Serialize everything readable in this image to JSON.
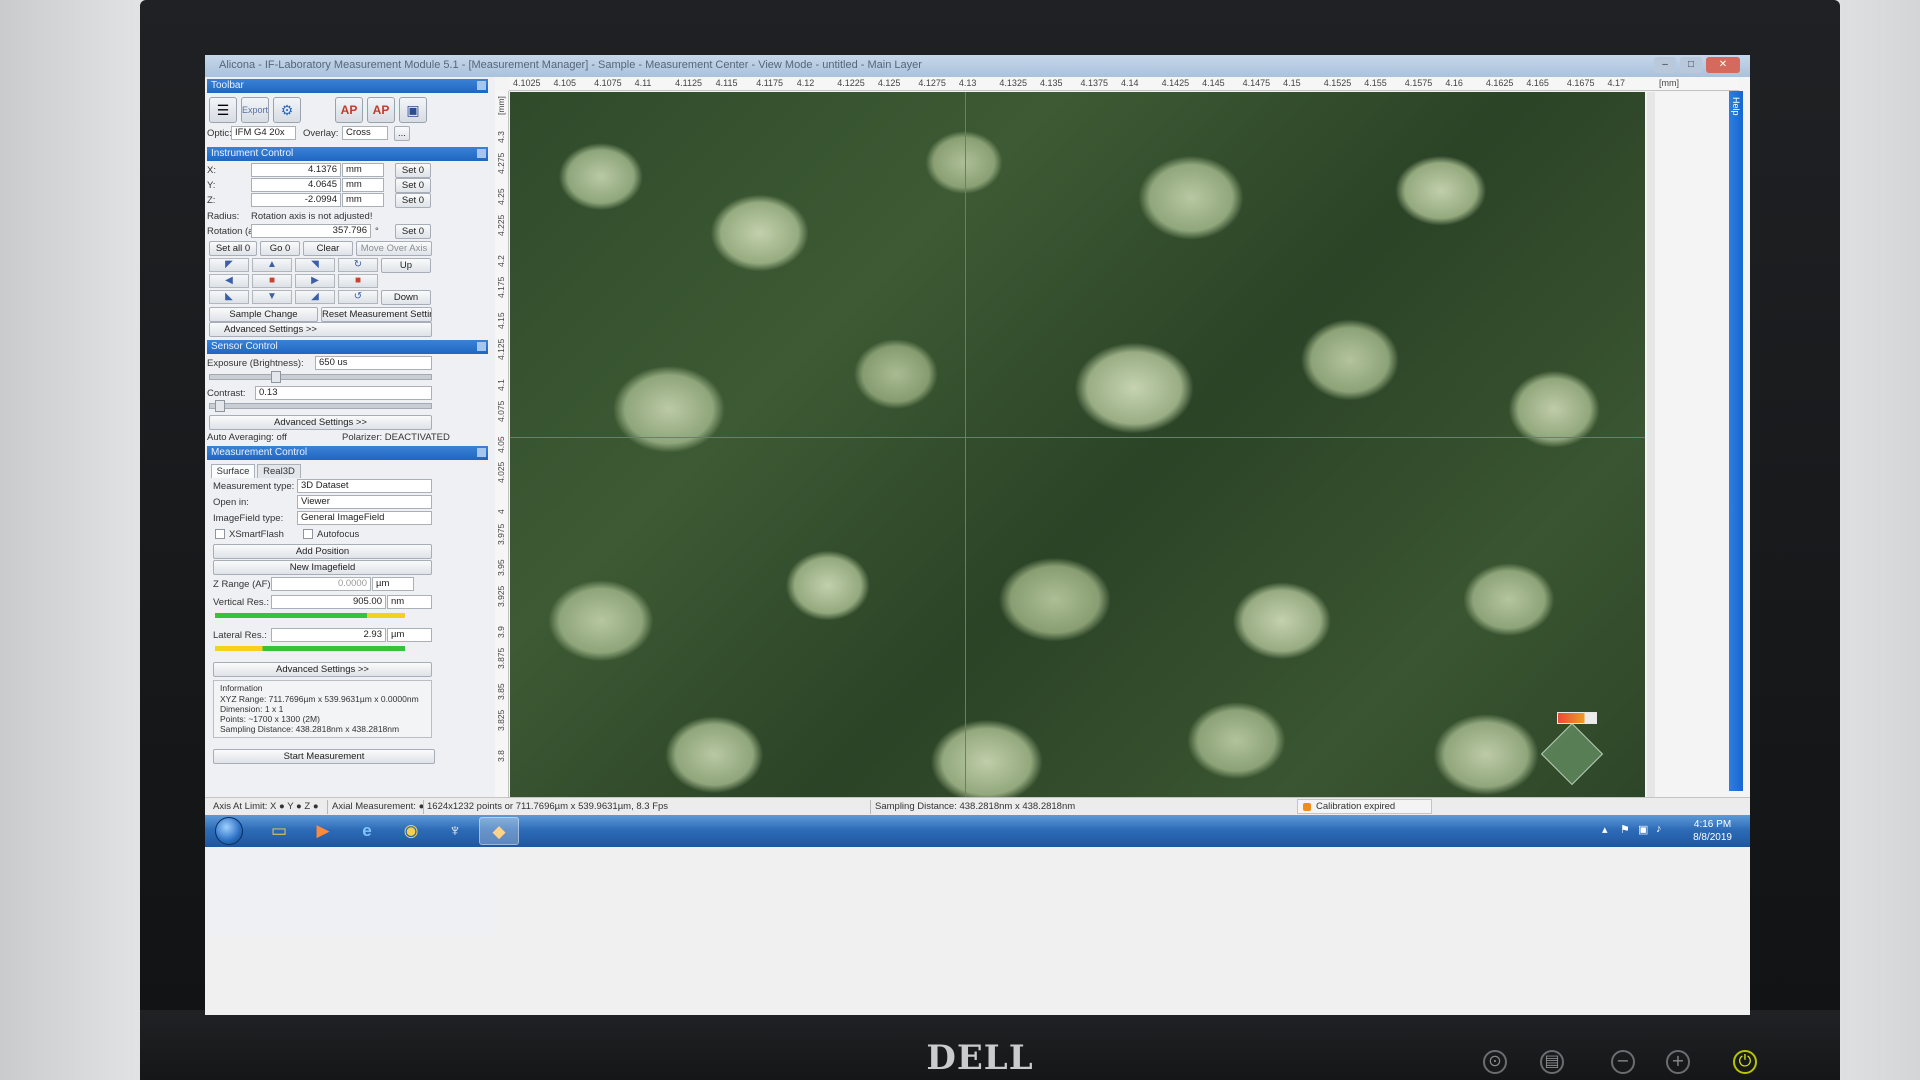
{
  "app": {
    "title": "Alicona - IF-Laboratory Measurement Module 5.1 - [Measurement Manager] - Sample - Measurement Center - View Mode - untitled - Main Layer",
    "window_controls": [
      "–",
      "□",
      "✕"
    ]
  },
  "toolbar": {
    "header": "Toolbar",
    "tools": [
      "list-icon",
      "export-icon",
      "settings-icon",
      "ap-icon",
      "ap2-icon",
      "screenshot-icon"
    ],
    "optic_label": "Optic:",
    "optic_value": "IFM G4 20x",
    "overlay_label": "Overlay:",
    "overlay_value": "Cross",
    "overlay_more": "..."
  },
  "instrument": {
    "header": "Instrument Control",
    "x_label": "X:",
    "x_value": "4.1376",
    "x_unit": "mm",
    "y_label": "Y:",
    "y_value": "4.0645",
    "y_unit": "mm",
    "z_label": "Z:",
    "z_value": "-2.0994",
    "z_unit": "mm",
    "set0": "Set 0",
    "radius_label": "Radius:",
    "radius_value": "Rotation axis is not adjusted!",
    "rotation_label": "Rotation (a):",
    "rotation_value": "357.796",
    "rotation_unit": "°",
    "set_all0": "Set all 0",
    "go0": "Go 0",
    "clear": "Clear",
    "move_over_axis": "Move Over Axis",
    "up": "Up",
    "down": "Down",
    "sample_change": "Sample Change",
    "reset_measurement": "Reset Measurement Settings",
    "advanced": "Advanced Settings >>"
  },
  "sensor": {
    "header": "Sensor Control",
    "exposure_label": "Exposure (Brightness):",
    "exposure_value": "650 us",
    "contrast_label": "Contrast:",
    "contrast_value": "0.13",
    "advanced": "Advanced Settings >>",
    "auto_averaging": "Auto Averaging: off",
    "polarizer": "Polarizer: DEACTIVATED"
  },
  "measurement": {
    "header": "Measurement Control",
    "tabs": [
      "Surface",
      "Real3D"
    ],
    "type_label": "Measurement type:",
    "type_value": "3D Dataset",
    "open_in_label": "Open in:",
    "open_in_value": "Viewer",
    "imagefield_label": "ImageField type:",
    "imagefield_value": "General ImageField",
    "xsmartflash": "XSmartFlash",
    "autofocus": "Autofocus",
    "add_position": "Add Position",
    "new_imagefield": "New Imagefield",
    "zrange_label": "Z Range (AF):",
    "zrange_value": "0.0000",
    "zrange_unit": "µm",
    "vres_label": "Vertical Res.:",
    "vres_value": "905.00",
    "vres_unit": "nm",
    "lres_label": "Lateral Res.:",
    "lres_value": "2.93",
    "lres_unit": "µm",
    "advanced": "Advanced Settings >>",
    "info_title": "Information",
    "info_lines": [
      "XYZ Range: 711.7696µm x 539.9631µm x 0.0000nm",
      "Dimension: 1 x 1",
      "Points: ~1700 x 1300 (2M)",
      "Sampling Distance: 438.2818nm x 438.2818nm"
    ],
    "start": "Start Measurement"
  },
  "viewer": {
    "top_ruler": [
      "4.1025",
      "4.105",
      "4.1075",
      "4.11",
      "4.1125",
      "4.115",
      "4.1175",
      "4.12",
      "4.1225",
      "4.125",
      "4.1275",
      "4.13",
      "4.1325",
      "4.135",
      "4.1375",
      "4.14",
      "4.1425",
      "4.145",
      "4.1475",
      "4.15",
      "4.1525",
      "4.155",
      "4.1575",
      "4.16",
      "4.1625",
      "4.165",
      "4.1675",
      "4.17"
    ],
    "top_unit": "[mm]",
    "left_unit": "[mm]",
    "left_ruler": [
      "4.3",
      "4.275",
      "4.25",
      "4.225",
      "4.2",
      "4.175",
      "4.15",
      "4.125",
      "4.1",
      "4.075",
      "4.05",
      "4.025",
      "4",
      "3.975",
      "3.95",
      "3.925",
      "3.9",
      "3.875",
      "3.85",
      "3.825",
      "3.8"
    ],
    "help": "Help"
  },
  "status": {
    "axis_limit": "Axis At Limit:  X ● Y ● Z ●",
    "axial": "Axial Measurement: ●",
    "points": "1624x1232 points or 711.7696µm x 539.9631µm, 8.3 Fps",
    "sampling": "Sampling Distance: 438.2818nm x 438.2818nm",
    "calibration": "Calibration expired"
  },
  "taskbar": {
    "icons": [
      "folder-icon",
      "media-player-icon",
      "ie-icon",
      "chrome-icon",
      "app-icon",
      "alicona-icon"
    ],
    "time": "4:16 PM",
    "date": "8/8/2019"
  },
  "monitor": {
    "brand": "DELL"
  }
}
